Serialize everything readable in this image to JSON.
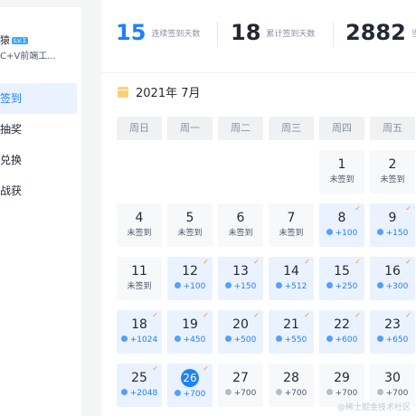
{
  "sidebar": {
    "user_name": "猿",
    "level": "Lv.1",
    "user_desc": "C+V前端工...",
    "items": [
      {
        "label": "签到",
        "active": true
      },
      {
        "label": "抽奖",
        "active": false
      },
      {
        "label": "兑换",
        "active": false
      },
      {
        "label": "战获",
        "active": false
      }
    ]
  },
  "stats": [
    {
      "value": "15",
      "label": "连续签到天数"
    },
    {
      "value": "18",
      "label": "累计签到天数"
    },
    {
      "value": "2882",
      "label": "当前"
    }
  ],
  "calendar": {
    "title": "2021年 7月",
    "weekdays": [
      "周日",
      "周一",
      "周二",
      "周三",
      "周四",
      "周五"
    ],
    "unsigned_label": "未签到",
    "today": 26,
    "days": [
      {
        "day": "1",
        "status": "未签到"
      },
      {
        "day": "2",
        "status": "未签到"
      },
      {
        "day": "4",
        "status": "未签到"
      },
      {
        "day": "5",
        "status": "未签到"
      },
      {
        "day": "6",
        "status": "未签到"
      },
      {
        "day": "7",
        "status": "未签到"
      },
      {
        "day": "8",
        "status": "+100"
      },
      {
        "day": "9",
        "status": "+150"
      },
      {
        "day": "11",
        "status": "未签到"
      },
      {
        "day": "12",
        "status": "+100"
      },
      {
        "day": "13",
        "status": "+150"
      },
      {
        "day": "14",
        "status": "+512"
      },
      {
        "day": "15",
        "status": "+250"
      },
      {
        "day": "16",
        "status": "+300"
      },
      {
        "day": "18",
        "status": "+1024"
      },
      {
        "day": "19",
        "status": "+450"
      },
      {
        "day": "20",
        "status": "+500"
      },
      {
        "day": "21",
        "status": "+550"
      },
      {
        "day": "22",
        "status": "+600"
      },
      {
        "day": "23",
        "status": "+650"
      },
      {
        "day": "25",
        "status": "+2048"
      },
      {
        "day": "26",
        "status": "+700"
      },
      {
        "day": "27",
        "status": "+700"
      },
      {
        "day": "28",
        "status": "+700"
      },
      {
        "day": "29",
        "status": "+700"
      },
      {
        "day": "30",
        "status": "+700"
      }
    ]
  },
  "watermark": "@稀土掘金技术社区",
  "colors": {
    "accent": "#1e80ff",
    "check": "#ff8c1a",
    "signed_bg": "#eaf2ff"
  }
}
